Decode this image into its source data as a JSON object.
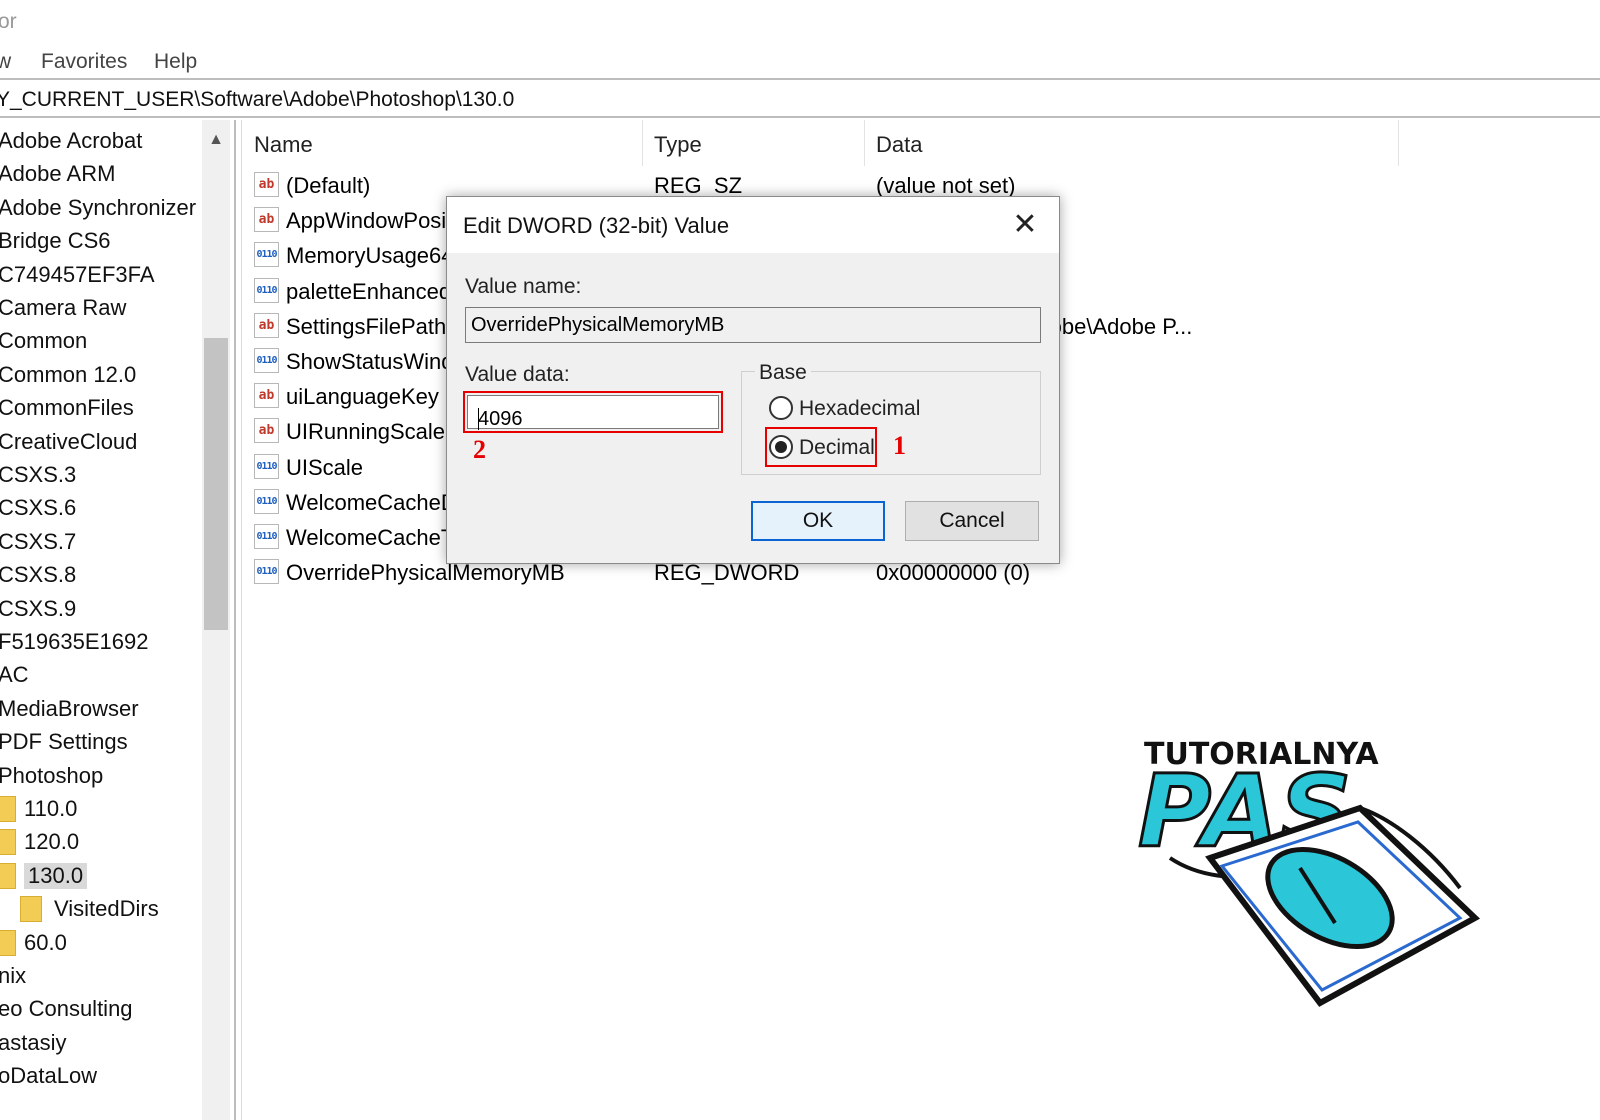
{
  "title": "or",
  "menu": [
    "w",
    "Favorites",
    "Help"
  ],
  "address": "Y_CURRENT_USER\\Software\\Adobe\\Photoshop\\130.0",
  "tree": [
    {
      "label": "Adobe Acrobat",
      "indent": 0
    },
    {
      "label": "Adobe ARM",
      "indent": 0
    },
    {
      "label": "Adobe Synchronizer",
      "indent": 0
    },
    {
      "label": "Bridge CS6",
      "indent": 0
    },
    {
      "label": "C749457EF3FA",
      "indent": 0
    },
    {
      "label": "Camera Raw",
      "indent": 0
    },
    {
      "label": "Common",
      "indent": 0
    },
    {
      "label": "Common 12.0",
      "indent": 0
    },
    {
      "label": "CommonFiles",
      "indent": 0
    },
    {
      "label": "CreativeCloud",
      "indent": 0
    },
    {
      "label": "CSXS.3",
      "indent": 0
    },
    {
      "label": "CSXS.6",
      "indent": 0
    },
    {
      "label": "CSXS.7",
      "indent": 0
    },
    {
      "label": "CSXS.8",
      "indent": 0
    },
    {
      "label": "CSXS.9",
      "indent": 0
    },
    {
      "label": "F519635E1692",
      "indent": 0
    },
    {
      "label": "AC",
      "indent": 0
    },
    {
      "label": "MediaBrowser",
      "indent": 0
    },
    {
      "label": "PDF Settings",
      "indent": 0
    },
    {
      "label": "Photoshop",
      "indent": 0
    },
    {
      "label": "110.0",
      "indent": 1
    },
    {
      "label": "120.0",
      "indent": 1
    },
    {
      "label": "130.0",
      "indent": 1,
      "selected": true
    },
    {
      "label": "VisitedDirs",
      "indent": 2
    },
    {
      "label": "60.0",
      "indent": 1
    },
    {
      "label": "nix",
      "indent": 0
    },
    {
      "label": "eo Consulting",
      "indent": 0
    },
    {
      "label": "astasiy",
      "indent": 0
    },
    {
      "label": "oDataLow",
      "indent": 0
    }
  ],
  "columns": {
    "name": "Name",
    "type": "Type",
    "data": "Data"
  },
  "rows": [
    {
      "icon": "string-value-icon",
      "name": "(Default)",
      "type": "REG_SZ",
      "data": "(value not set)"
    },
    {
      "icon": "string-value-icon",
      "name": "AppWindowPosi",
      "type": "",
      "data": ""
    },
    {
      "icon": "binary-value-icon",
      "name": "MemoryUsage64",
      "type": "",
      "data": ""
    },
    {
      "icon": "binary-value-icon",
      "name": "paletteEnhanced",
      "type": "",
      "data": ""
    },
    {
      "icon": "string-value-icon",
      "name": "SettingsFilePath",
      "type": "",
      "data": "Data\\Roaming\\Adobe\\Adobe P..."
    },
    {
      "icon": "binary-value-icon",
      "name": "ShowStatusWind",
      "type": "",
      "data": ""
    },
    {
      "icon": "string-value-icon",
      "name": "uiLanguageKey",
      "type": "",
      "data": ""
    },
    {
      "icon": "string-value-icon",
      "name": "UIRunningScale",
      "type": "",
      "data": ""
    },
    {
      "icon": "binary-value-icon",
      "name": "UIScale",
      "type": "",
      "data": ""
    },
    {
      "icon": "binary-value-icon",
      "name": "WelcomeCacheD",
      "type": "",
      "data": ""
    },
    {
      "icon": "binary-value-icon",
      "name": "WelcomeCacheT",
      "type": "",
      "data": ""
    },
    {
      "icon": "binary-value-icon",
      "name": "OverridePhysicalMemoryMB",
      "type": "REG_DWORD",
      "data": "0x00000000 (0)"
    }
  ],
  "dialog": {
    "title": "Edit DWORD (32-bit) Value",
    "value_name_label": "Value name:",
    "value_name": "OverridePhysicalMemoryMB",
    "value_data_label": "Value data:",
    "value_data": "4096",
    "base_label": "Base",
    "hex_label": "Hexadecimal",
    "dec_label": "Decimal",
    "selected_base": "Decimal",
    "ok": "OK",
    "cancel": "Cancel",
    "close_glyph": "✕"
  },
  "annotations": {
    "step1": "1",
    "step2": "2"
  },
  "logo": {
    "top_text": "TUTORIALNYA",
    "main_text": "PAS"
  },
  "colors": {
    "annotation_red": "#e60000",
    "logo_cyan": "#2bc6d8",
    "default_button_blue": "#0a64d4"
  }
}
